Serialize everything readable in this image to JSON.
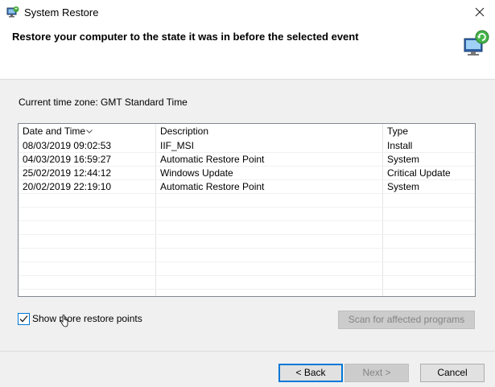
{
  "window": {
    "title": "System Restore",
    "heading": "Restore your computer to the state it was in before the selected event"
  },
  "timezone": {
    "label": "Current time zone: GMT Standard Time"
  },
  "table": {
    "columns": [
      "Date and Time",
      "Description",
      "Type"
    ],
    "sorted_column": "Date and Time",
    "rows": [
      {
        "date": "08/03/2019 09:02:53",
        "description": "IIF_MSI",
        "type": "Install"
      },
      {
        "date": "04/03/2019 16:59:27",
        "description": "Automatic Restore Point",
        "type": "System"
      },
      {
        "date": "25/02/2019 12:44:12",
        "description": "Windows Update",
        "type": "Critical Update"
      },
      {
        "date": "20/02/2019 22:19:10",
        "description": "Automatic Restore Point",
        "type": "System"
      }
    ]
  },
  "options": {
    "show_more_label": "Show more restore points",
    "show_more_checked": true
  },
  "buttons": {
    "scan": "Scan for affected programs",
    "back": "< Back",
    "next": "Next >",
    "cancel": "Cancel"
  },
  "colors": {
    "accent": "#0078d7",
    "disabled_text": "#838383"
  },
  "icons": {
    "app": "system-restore-icon",
    "hero": "restore-computer-icon",
    "close": "close-icon",
    "sort": "sort-down-icon",
    "check": "checkmark-icon"
  }
}
